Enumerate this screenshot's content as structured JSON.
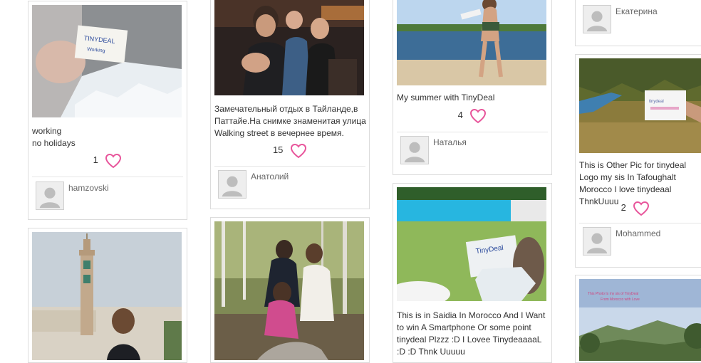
{
  "posts": [
    {
      "caption": "working\nno holidays",
      "likes": "1",
      "user": "hamzovski",
      "photo_alt": "hand holding TinyDeal note over white packing foam"
    },
    {
      "caption": "",
      "likes": "",
      "user": "",
      "photo_alt": "Hassan II mosque minaret with boy"
    },
    {
      "caption": "Замечательный отдых в Тайланде,в Паттайе.На снимке знаменитая улица Walking street в вечернее время.",
      "likes": "15",
      "user": "Анатолий",
      "photo_alt": "group photo at night on Walking street"
    },
    {
      "caption": "",
      "likes": "",
      "user": "",
      "photo_alt": "three girls in a birch forest"
    },
    {
      "caption": "My summer with TinyDeal",
      "likes": "4",
      "user": "Наталья",
      "photo_alt": "woman on sandy beach by the water"
    },
    {
      "caption": "This is in Saidia In Morocco And I Want to win A Smartphone Or some point tinydeal Plzzz :D I Lovee TinydeaaaaL :D :D Thnk Uuuuu",
      "likes": "",
      "user": "",
      "photo_alt": "TinyDeal bag held by swimming pool"
    },
    {
      "caption": "",
      "likes": "",
      "user": "Екатерина",
      "photo_alt": ""
    },
    {
      "caption": "This is Other Pic for tinydeal Logo my sis In Tafoughalt Morocco I love tinydeaal ThnkUuuu",
      "likes": "2",
      "user": "Mohammed",
      "photo_alt": "hands holding TinyDeal sign over hills"
    },
    {
      "caption": "",
      "likes": "",
      "user": "",
      "photo_alt": "mountain landscape with pink text overlay"
    }
  ],
  "colors": {
    "heart": "#e8559b",
    "border": "#dcdcdc"
  }
}
